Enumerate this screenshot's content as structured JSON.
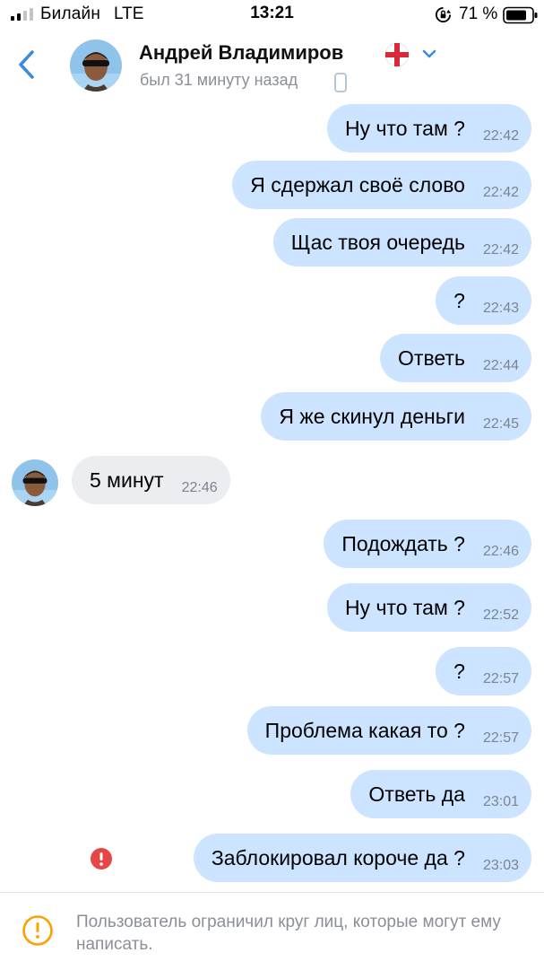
{
  "status_bar": {
    "carrier": "Билайн",
    "network": "LTE",
    "time": "13:21",
    "battery": "71 %"
  },
  "header": {
    "contact_name": "Андрей Владимиров",
    "last_seen": "был 31 минуту назад",
    "accent_color": "#3f8ae0"
  },
  "messages": [
    {
      "dir": "out",
      "text": "Ну что там ?",
      "time": "22:42"
    },
    {
      "dir": "out",
      "text": "Я сдержал своё слово",
      "time": "22:42"
    },
    {
      "dir": "out",
      "text": "Щас твоя очередь",
      "time": "22:42"
    },
    {
      "dir": "out",
      "text": "?",
      "time": "22:43"
    },
    {
      "dir": "out",
      "text": "Ответь",
      "time": "22:44"
    },
    {
      "dir": "out",
      "text": "Я же скинул деньги",
      "time": "22:45"
    },
    {
      "dir": "in",
      "text": "5 минут",
      "time": "22:46"
    },
    {
      "dir": "out",
      "text": "Подождать ?",
      "time": "22:46"
    },
    {
      "dir": "out",
      "text": "Ну что там ?",
      "time": "22:52"
    },
    {
      "dir": "out",
      "text": "?",
      "time": "22:57"
    },
    {
      "dir": "out",
      "text": "Проблема какая то ?",
      "time": "22:57"
    },
    {
      "dir": "out",
      "text": "Ответь да",
      "time": "23:01"
    },
    {
      "dir": "out",
      "text": "Заблокировал короче да ?",
      "time": "23:03",
      "status": "error"
    }
  ],
  "notice": {
    "text": "Пользователь ограничил круг лиц, которые могут ему написать."
  },
  "colors": {
    "outgoing_bubble": "#cce4ff",
    "incoming_bubble": "#ebedf0",
    "error": "#e64646",
    "warning": "#ffa000"
  }
}
